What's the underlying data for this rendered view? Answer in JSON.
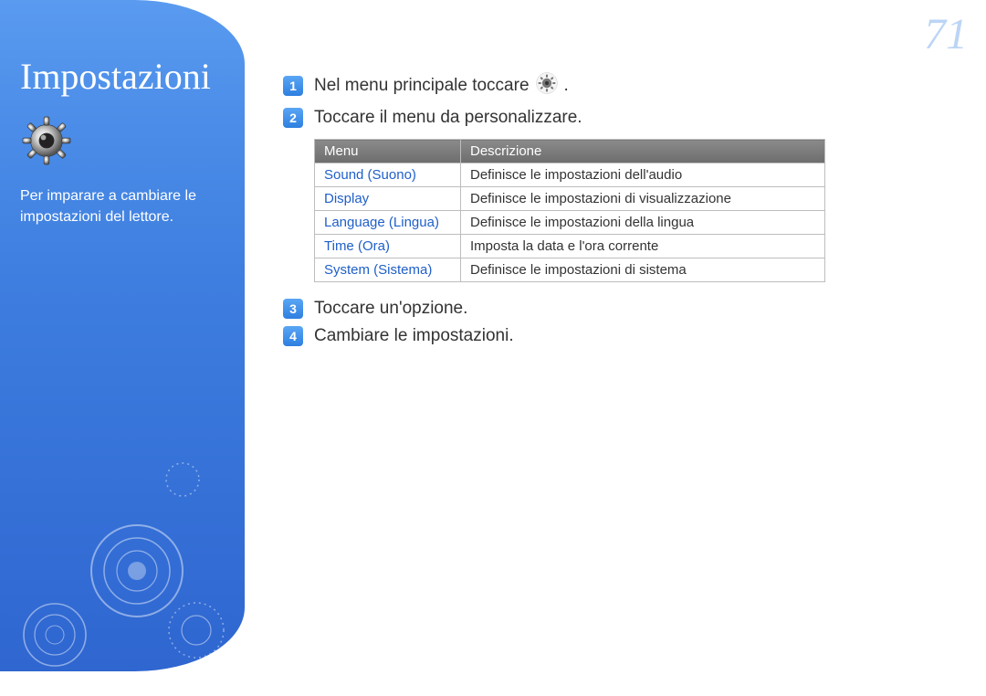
{
  "page_number": "71",
  "sidebar": {
    "title": "Impostazioni",
    "description": "Per imparare a cambiare le impostazioni del lettore."
  },
  "steps": [
    {
      "num": "1",
      "text_before": "Nel menu principale toccare",
      "has_icon": true,
      "text_after": "."
    },
    {
      "num": "2",
      "text_before": "Toccare il menu da personalizzare.",
      "has_icon": false,
      "text_after": ""
    },
    {
      "num": "3",
      "text_before": "Toccare un'opzione.",
      "has_icon": false,
      "text_after": ""
    },
    {
      "num": "4",
      "text_before": "Cambiare le impostazioni.",
      "has_icon": false,
      "text_after": ""
    }
  ],
  "table": {
    "headers": [
      "Menu",
      "Descrizione"
    ],
    "rows": [
      {
        "menu": "Sound (Suono)",
        "desc": "Definisce le impostazioni dell'audio"
      },
      {
        "menu": "Display",
        "desc": "Definisce le impostazioni di visualizzazione"
      },
      {
        "menu": "Language (Lingua)",
        "desc": "Definisce le impostazioni della lingua"
      },
      {
        "menu": "Time (Ora)",
        "desc": "Imposta la data e l'ora corrente"
      },
      {
        "menu": "System (Sistema)",
        "desc": "Definisce le impostazioni di sistema"
      }
    ]
  }
}
